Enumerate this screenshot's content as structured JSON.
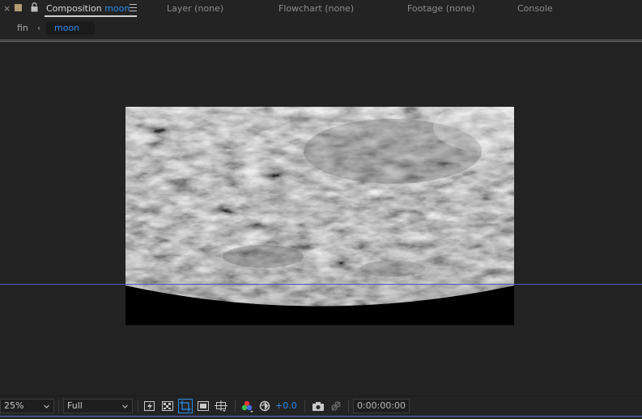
{
  "panel_tabs": {
    "close_glyph": "×",
    "composition_label": "Composition",
    "composition_name": "moon",
    "layer": "Layer (none)",
    "flowchart": "Flowchart (none)",
    "footage": "Footage (none)",
    "console": "Console",
    "swatch_color": "#b29c73",
    "accent_color": "#2d8ceb"
  },
  "breadcrumb": {
    "items": [
      "fin",
      "moon"
    ],
    "arrow_glyph": "‹"
  },
  "viewer": {
    "content": "moon surface image",
    "guide_color": "#5353c9",
    "background": "#232323"
  },
  "toolbar": {
    "zoom": "25%",
    "resolution": "Full",
    "exposure": "+0.0",
    "timecode": "0:00:00:00",
    "icons": [
      "fast-previews-icon",
      "transparency-grid-icon",
      "region-of-interest-icon",
      "mask-visibility-icon",
      "grid-guides-icon",
      "show-channel-icon",
      "reset-exposure-icon",
      "snapshot-icon",
      "show-snapshot-icon"
    ]
  }
}
